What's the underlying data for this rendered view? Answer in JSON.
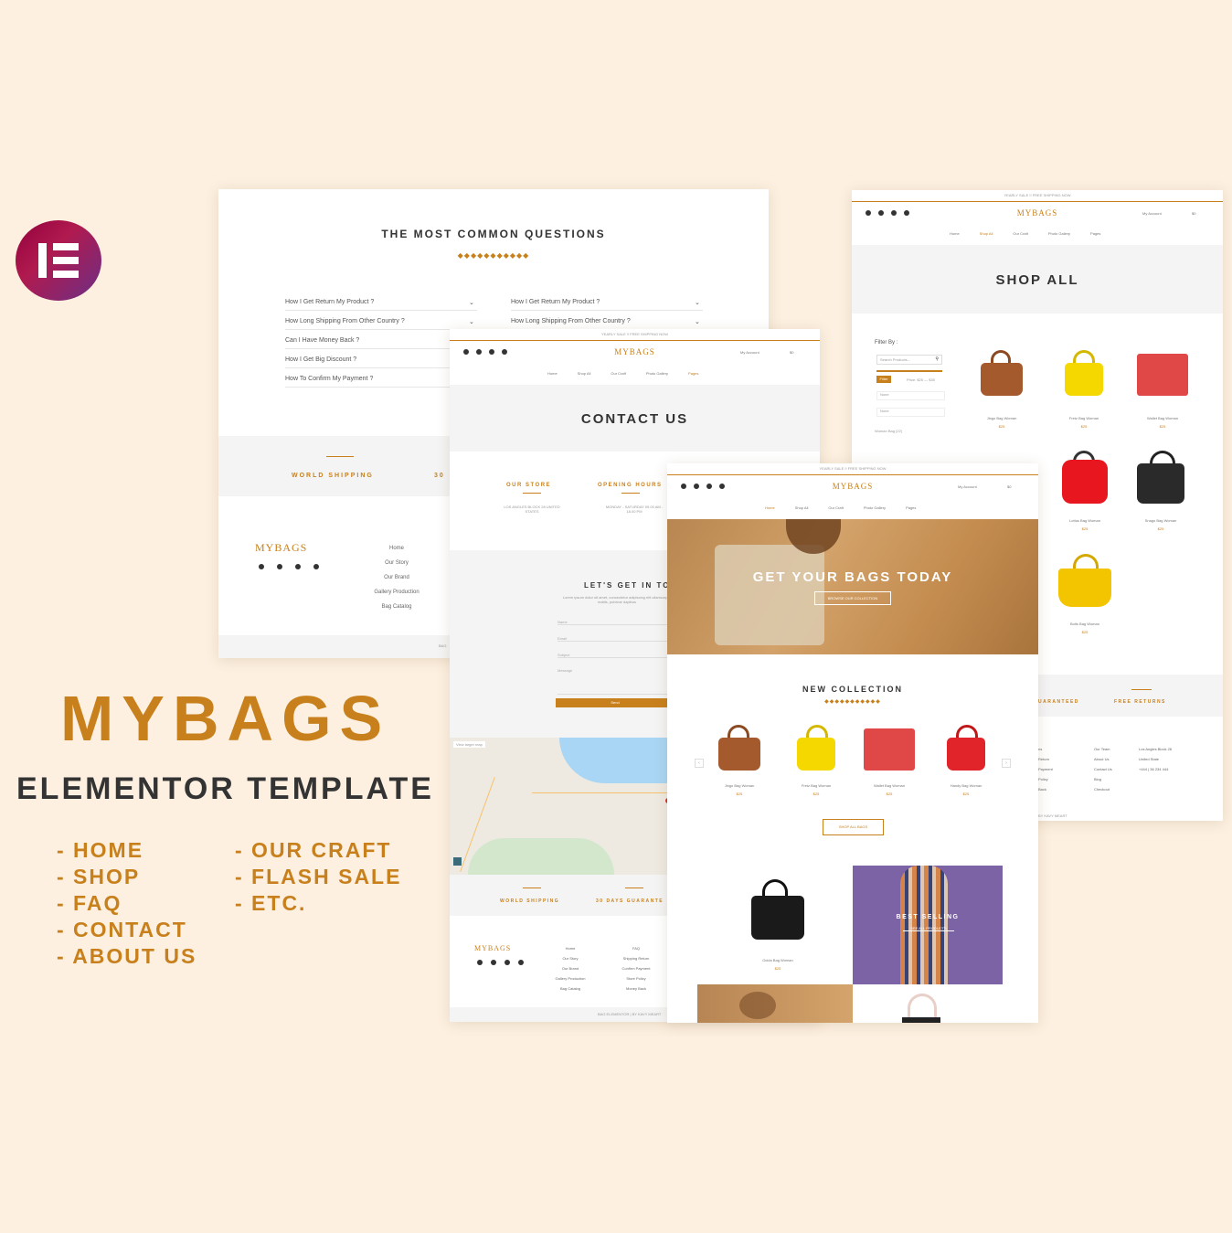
{
  "promo": {
    "title": "MYBAGS",
    "subtitle": "ELEMENTOR TEMPLATE",
    "features_left": [
      "- HOME",
      "- SHOP",
      "- FAQ",
      "- CONTACT",
      "- ABOUT US"
    ],
    "features_right": [
      "- OUR CRAFT",
      "- FLASH SALE",
      "- ETC."
    ],
    "logo_icon": "elementor-logo-icon"
  },
  "colors": {
    "accent": "#c8801c",
    "background": "#fdf0e0",
    "logo": "#92003b"
  },
  "faq": {
    "title": "THE MOST COMMON QUESTIONS",
    "left_questions": [
      "How I Get Return My Product ?",
      "How Long Shipping From Other Country ?",
      "Can I Have Money Back ?",
      "How I Get Big Discount ?",
      "How To Confirm My Payment ?"
    ],
    "right_questions": [
      "How I Get Return My Product ?",
      "How Long Shipping From Other Country ?"
    ],
    "shipping_label": "WORLD SHIPPING",
    "shipping_cut": "30",
    "footer_brand": "MYBAGS",
    "footer_links": [
      "Home",
      "Our Story",
      "Our Brand",
      "Gallery Production",
      "Bag Catalog"
    ],
    "footer_cut": "BAG"
  },
  "header": {
    "topbar": "YEARLY SALE !! FREE SHIPPING NOW",
    "brand": "MYBAGS",
    "account": "My Account",
    "cart": "$0",
    "nav": [
      "Home",
      "Shop All",
      "Our Craft",
      "Photo Gallery",
      "Pages"
    ]
  },
  "contact": {
    "title": "CONTACT US",
    "store_label": "OUR STORE",
    "store_address": "LOS ANGLES BLOCK 28 UNITED STATES",
    "hours_label": "OPENING HOURS",
    "hours_value": "MONDAY - SATURDAY 09.00 AM - 18.00 PM",
    "form_title": "LET'S GET IN TOU",
    "form_text": "Lorem ipsum dolor sit amet, consectetur adipiscing elit ullamcorper mattis, pulvinar dapibus",
    "fields": [
      "Name",
      "Email",
      "Subject",
      "Message"
    ],
    "send": "Send",
    "map_label": "View larger map",
    "strip": [
      "WORLD SHIPPING",
      "30 DAYS GUARANTE"
    ],
    "footer_brand": "MYBAGS",
    "footer_col1": [
      "Home",
      "Our Story",
      "Our Brand",
      "Gallery Production",
      "Bag Catalog"
    ],
    "footer_col2": [
      "FAQ",
      "Shipping Return",
      "Confirm Payment",
      "Store Policy",
      "Money Back"
    ],
    "copyright": "BAG ELEMENTOR | BY KAVY MEART"
  },
  "shop": {
    "title": "SHOP ALL",
    "filter_label": "Filter By :",
    "search_placeholder": "Search Products...",
    "filter_button": "Filter",
    "price_text": "Price: $25 — $35",
    "select1": "None",
    "select2": "None",
    "category": "Woman Bag (22)",
    "products": [
      {
        "name": "Jingo Bag Woman",
        "price": "$25"
      },
      {
        "name": "Fretz Bag Woman",
        "price": "$25"
      },
      {
        "name": "Wallet Bag Woman",
        "price": "$25"
      },
      {
        "name": "Lottus Bag Woman",
        "price": "$25"
      },
      {
        "name": "Snago Bag Woman",
        "price": "$25"
      },
      {
        "name": "Bolts Bag Woman",
        "price": "$25"
      }
    ],
    "strip": [
      "UARANTEED",
      "FREE RETURNS"
    ],
    "col1": [
      "ns",
      "Return",
      "Payment",
      "Policy",
      "Back"
    ],
    "col2": [
      "Our Team",
      "About Us",
      "Contact Us",
      "Blog",
      "Checkout"
    ],
    "col3": [
      "Los Angles Block 28",
      "United State",
      "+444 | 36 234 444"
    ],
    "copyright": "BY KAVY MEART"
  },
  "home": {
    "hero_title": "GET YOUR BAGS TODAY",
    "hero_button": "BROWSE OUR COLLECTION",
    "new_title": "NEW COLLECTION",
    "products": [
      {
        "name": "Jingo Bag Woman",
        "price": "$25"
      },
      {
        "name": "Fretz Bag Woman",
        "price": "$25"
      },
      {
        "name": "Wallet Bag Woman",
        "price": "$25"
      },
      {
        "name": "Handy Bag Woman",
        "price": "$25"
      }
    ],
    "shop_all": "SHOP ALL BAGS",
    "featured_name": "Ocida Bag Woman",
    "featured_price": "$25",
    "best_selling": "BEST SELLING",
    "best_button": "SEE ALL PRODUCTS"
  }
}
